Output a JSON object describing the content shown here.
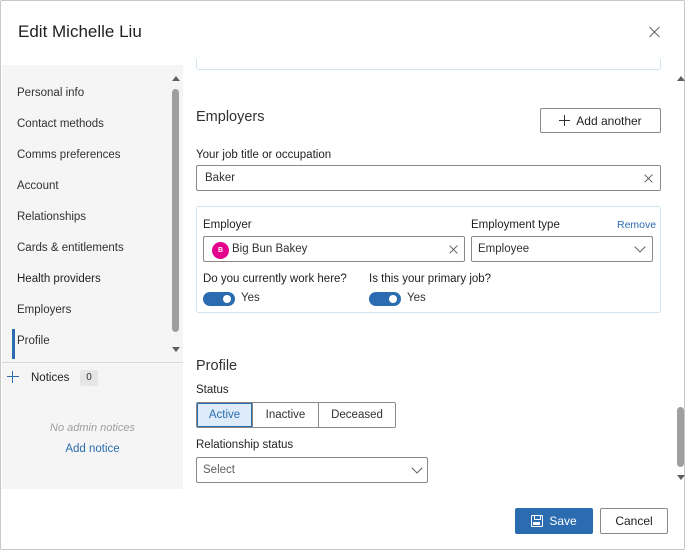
{
  "dialog": {
    "title": "Edit Michelle Liu",
    "close_icon": "close-icon"
  },
  "sidebar": {
    "items": [
      {
        "label": "Personal info"
      },
      {
        "label": "Contact methods"
      },
      {
        "label": "Comms preferences"
      },
      {
        "label": "Account"
      },
      {
        "label": "Relationships"
      },
      {
        "label": "Cards & entitlements"
      },
      {
        "label": "Health providers"
      },
      {
        "label": "Employers"
      },
      {
        "label": "Profile"
      }
    ],
    "active_item": "Health providers",
    "notices": {
      "label": "Notices",
      "count": "0",
      "empty_text": "No admin notices",
      "add_label": "Add notice"
    }
  },
  "employers": {
    "heading": "Employers",
    "add_button": "Add another",
    "job_title_label": "Your job title or occupation",
    "job_title_value": "Baker",
    "card": {
      "employer_label": "Employer",
      "employer_avatar": "B",
      "employer_value": "Big Bun Bakey",
      "type_label": "Employment type",
      "remove_label": "Remove",
      "type_value": "Employee",
      "current_label": "Do you currently work here?",
      "current_value": "Yes",
      "primary_label": "Is this your primary job?",
      "primary_value": "Yes"
    }
  },
  "profile": {
    "heading": "Profile",
    "status_label": "Status",
    "status_options": [
      "Active",
      "Inactive",
      "Deceased"
    ],
    "status_selected": "Active",
    "relationship_label": "Relationship status",
    "relationship_placeholder": "Select"
  },
  "footer": {
    "save_label": "Save",
    "cancel_label": "Cancel"
  },
  "colors": {
    "accent": "#2b6cb0",
    "avatar": "#e3008c",
    "card_border": "#cfe4ec"
  }
}
